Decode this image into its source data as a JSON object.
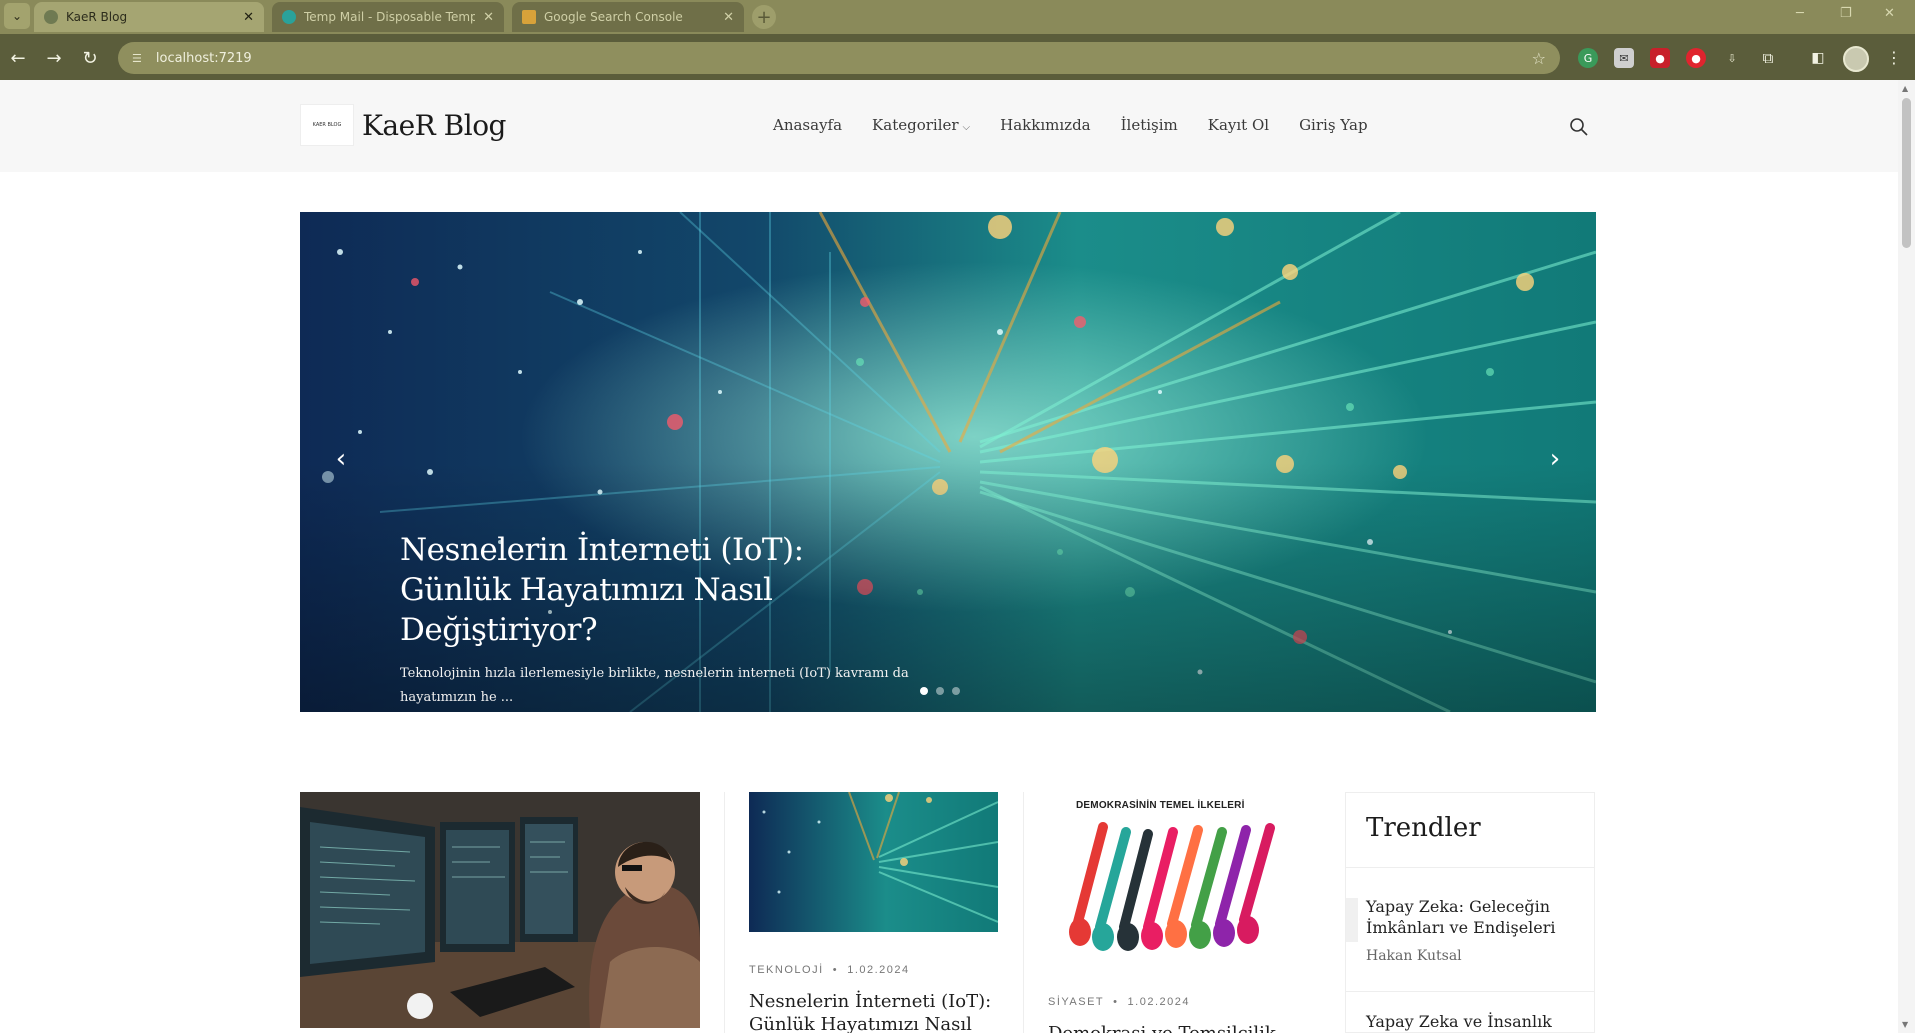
{
  "browser": {
    "tabs": [
      {
        "title": "KaeR Blog",
        "active": true
      },
      {
        "title": "Temp Mail - Disposable Temporary Email",
        "active": false
      },
      {
        "title": "Google Search Console",
        "active": false
      }
    ],
    "url": "localhost:7219"
  },
  "site": {
    "logo_text": "KaeR Blog",
    "logo_small": "KAER BLOG",
    "nav": {
      "home": "Anasayfa",
      "categories": "Kategoriler",
      "about": "Hakkımızda",
      "contact": "İletişim",
      "register": "Kayıt Ol",
      "login": "Giriş Yap"
    }
  },
  "hero": {
    "title": "Nesnelerin İnterneti (IoT): Günlük Hayatımızı Nasıl Değiştiriyor?",
    "excerpt": "Teknolojinin hızla ilerlemesiyle birlikte, nesnelerin interneti (IoT) kavramı da hayatımızın he ...",
    "slides": 3,
    "active_slide": 0
  },
  "posts": [
    {
      "category": "TEKNOLOJİ",
      "date": "1.02.2024",
      "title": "Nesnelerin İnterneti (IoT): Günlük Hayatımızı Nasıl"
    },
    {
      "category": "SİYASET",
      "date": "1.02.2024",
      "title": "Demokrasi ve Temsilcilik",
      "image_heading": "DEMOKRASİNİN TEMEL İLKELERİ"
    }
  ],
  "trends": {
    "heading": "Trendler",
    "items": [
      {
        "title": "Yapay Zeka: Geleceğin İmkânları ve Endişeleri",
        "author": "Hakan Kutsal"
      },
      {
        "title": "Yapay Zeka ve İnsanlık"
      }
    ]
  },
  "colors": {
    "chrome": "#5b5d3b",
    "header_bg": "#f7f7f7",
    "hero_teal": "#1aa59a"
  }
}
